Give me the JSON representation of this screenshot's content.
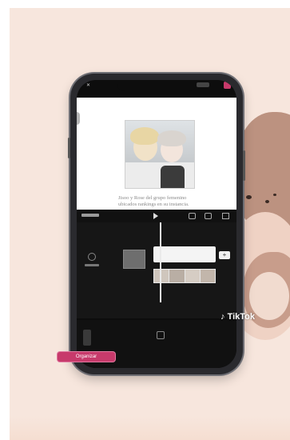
{
  "preview": {
    "caption": "Jisoo y Rose del grupo femenino ubicados rankings en su instancia."
  },
  "editor": {
    "pill_label": "Organizar"
  },
  "watermark": {
    "brand": "TikTok"
  },
  "colors": {
    "background": "#f7e6dd",
    "blob": "#b88d7a",
    "accent_pill": "#c73a6b"
  },
  "icons": [
    "tiktok-logo-icon",
    "close-icon",
    "export-button-icon",
    "play-icon",
    "undo-icon",
    "redo-icon",
    "fullscreen-icon",
    "add-clip-icon",
    "audio-icon"
  ]
}
